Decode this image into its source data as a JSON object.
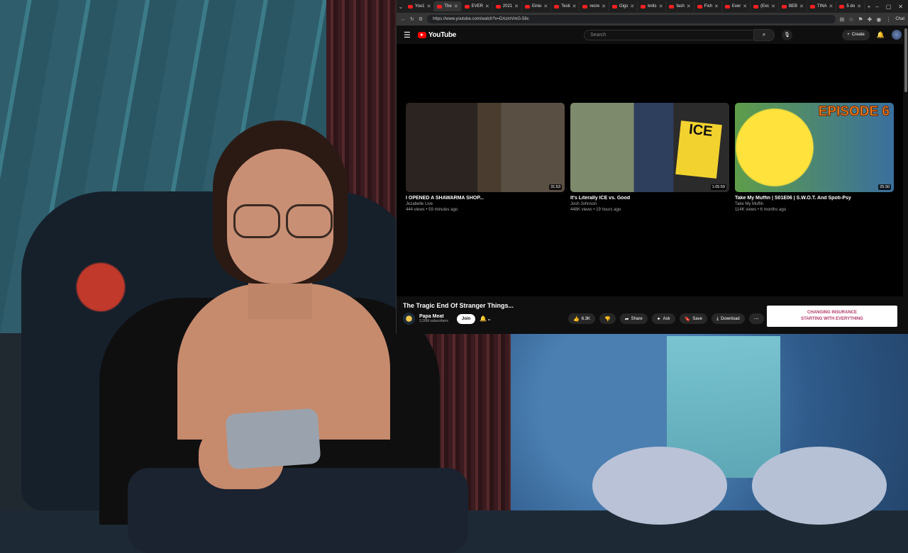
{
  "browser": {
    "tabs": [
      {
        "label": "You1",
        "fav": "red",
        "active": false
      },
      {
        "label": "The",
        "fav": "red",
        "active": true
      },
      {
        "label": "EVER",
        "fav": "red",
        "active": false
      },
      {
        "label": "2021",
        "fav": "red",
        "active": false
      },
      {
        "label": "Einio",
        "fav": "red",
        "active": false
      },
      {
        "label": "Testi",
        "fav": "red",
        "active": false
      },
      {
        "label": "recre",
        "fav": "red",
        "active": false
      },
      {
        "label": "Gigs",
        "fav": "red",
        "active": false
      },
      {
        "label": "knits",
        "fav": "red",
        "active": false
      },
      {
        "label": "fash",
        "fav": "red",
        "active": false
      },
      {
        "label": "Fish",
        "fav": "red",
        "active": false
      },
      {
        "label": "Exer",
        "fav": "red",
        "active": false
      },
      {
        "label": "(Exc",
        "fav": "red",
        "active": false
      },
      {
        "label": "BEB",
        "fav": "red",
        "active": false
      },
      {
        "label": "TINA",
        "fav": "red",
        "active": false
      },
      {
        "label": "5 do",
        "fav": "red",
        "active": false
      }
    ],
    "url": "https://www.youtube.com/watch?v=DAzmVmG-58c",
    "chat_label": "Chat"
  },
  "youtube": {
    "logo_text": "YouTube",
    "search_placeholder": "Search",
    "create_label": "Create"
  },
  "recommendations": [
    {
      "title": "I OPENED A SHAWARMA SHOP...",
      "channel": "Jezabelle Live",
      "meta": "444 views • 59 minutes ago",
      "duration": "31:53"
    },
    {
      "title": "It's Literally ICE vs. Good",
      "channel": "Josh Johnson",
      "meta": "448K views • 19 hours ago",
      "duration": "1:05:59"
    },
    {
      "title": "Take My Muffin | S01E06 | S.W.O.T. And Spoti-Psy",
      "channel": "Take My Muffin",
      "meta": "114K views • 6 months ago",
      "duration": "25:30"
    }
  ],
  "thumb_text": {
    "episode": "EPISODE 6",
    "ice": "ICE"
  },
  "video": {
    "title": "The Tragic End Of Stranger Things...",
    "channel_name": "Papa Meat",
    "subscribers": "3.26M subscribers",
    "join_label": "Join",
    "likes": "6.3K",
    "share_label": "Share",
    "ask_label": "Ask",
    "save_label": "Save",
    "download_label": "Download"
  },
  "ad": {
    "line1": "CHANGING INSURANCE",
    "line2": "STARTING WITH EVERYTHING"
  }
}
